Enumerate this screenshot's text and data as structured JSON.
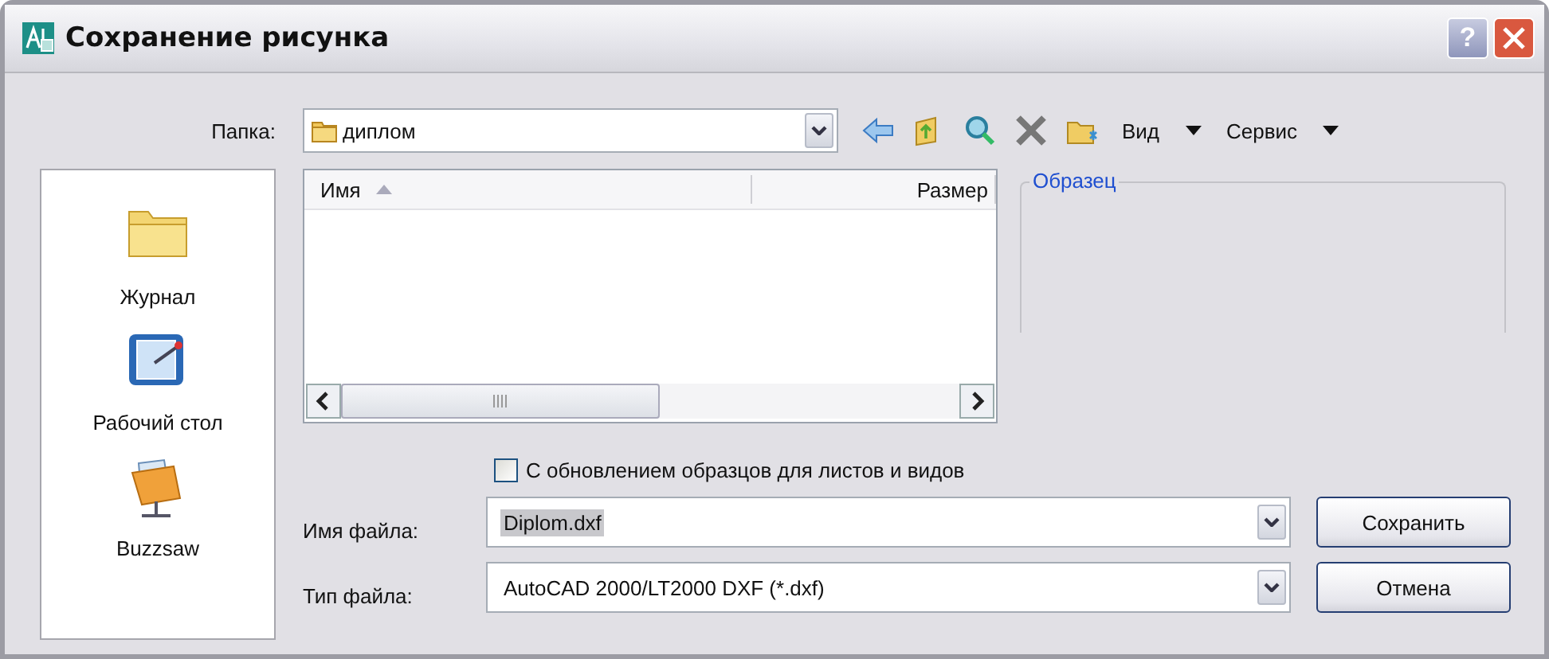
{
  "window": {
    "title": "Сохранение рисунка",
    "help": "?"
  },
  "folder": {
    "label": "Папка:",
    "value": "диплом"
  },
  "toolbar": [
    {
      "kind": "back"
    },
    {
      "kind": "up"
    },
    {
      "kind": "search"
    },
    {
      "kind": "delete"
    },
    {
      "kind": "new-folder"
    }
  ],
  "menus": [
    {
      "label": "Вид"
    },
    {
      "label": "Сервис"
    }
  ],
  "places": [
    {
      "kind": "history",
      "label": "Журнал"
    },
    {
      "kind": "desktop",
      "label": "Рабочий стол"
    },
    {
      "kind": "buzzsaw",
      "label": "Buzzsaw"
    }
  ],
  "file_list": {
    "columns": [
      {
        "label": "Имя",
        "sorted": true
      },
      {
        "label": "Размер",
        "sorted": false
      }
    ]
  },
  "preview": {
    "title": "Образец"
  },
  "option": {
    "label": "С обновлением образцов для листов и видов",
    "checked": false
  },
  "fields": [
    {
      "label": "Имя файла:",
      "value": "Diplom.dxf",
      "highlighted": true
    },
    {
      "label": "Тип файла:",
      "value": "AutoCAD 2000/LT2000 DXF (*.dxf)",
      "highlighted": false
    }
  ],
  "buttons": [
    {
      "label": "Сохранить"
    },
    {
      "label": "Отмена"
    }
  ]
}
